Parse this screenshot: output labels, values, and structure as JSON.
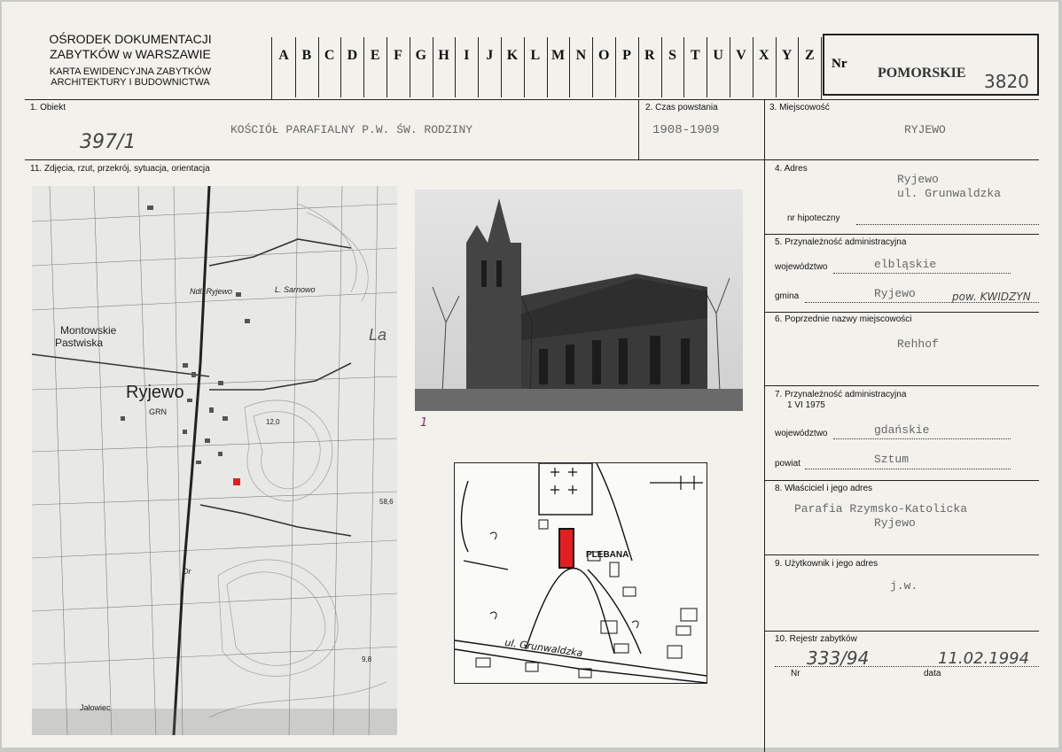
{
  "header": {
    "institution_line1": "OŚRODEK DOKUMENTACJI",
    "institution_line2": "ZABYTKÓW w WARSZAWIE",
    "card_line1": "KARTA EWIDENCYJNA ZABYTKÓW",
    "card_line2": "ARCHITEKTURY I BUDOWNICTWA",
    "alphabet": [
      "A",
      "B",
      "C",
      "D",
      "E",
      "F",
      "G",
      "H",
      "I",
      "J",
      "K",
      "L",
      "M",
      "N",
      "O",
      "P",
      "R",
      "S",
      "T",
      "U",
      "V",
      "X",
      "Y",
      "Z"
    ],
    "nr_label": "Nr",
    "region": "POMORSKIE",
    "region_number": "3820"
  },
  "fields": {
    "obiekt_label": "1. Obiekt",
    "obiekt_value": "KOŚCIÓŁ PARAFIALNY P.W. ŚW. RODZINY",
    "obiekt_handwritten": "397/1",
    "czas_label": "2. Czas powstania",
    "czas_value": "1908-1909",
    "miejscowosc_label": "3. Miejscowość",
    "miejscowosc_value": "RYJEWO",
    "zdjecia_label": "11. Zdjęcia, rzut, przekrój, sytuacja, orientacja",
    "adres_label": "4. Adres",
    "adres_line1": "Ryjewo",
    "adres_line2": "ul. Grunwaldzka",
    "hipoteczny_label": "nr hipoteczny",
    "przynaleznosc_label": "5. Przynależność administracyjna",
    "wojewodztwo_label": "województwo",
    "wojewodztwo_value": "elbląskie",
    "gmina_label": "gmina",
    "gmina_value": "Ryjewo",
    "gmina_handwritten": "pow. KWIDZYN",
    "poprzednie_label": "6. Poprzednie nazwy miejscowości",
    "poprzednie_value": "Rehhof",
    "przynaleznosc1975_label": "7. Przynależność administracyjna",
    "przynaleznosc1975_date": "1 VI 1975",
    "wojewodztwo1975_label": "województwo",
    "wojewodztwo1975_value": "gdańskie",
    "powiat_label": "powiat",
    "powiat_value": "Sztum",
    "wlasciciel_label": "8. Właściciel i jego adres",
    "wlasciciel_line1": "Parafia Rzymsko-Katolicka",
    "wlasciciel_line2": "Ryjewo",
    "uzytkownik_label": "9. Użytkownik i jego adres",
    "uzytkownik_value": "j.w.",
    "rejestr_label": "10. Rejestr zabytków",
    "rejestr_nr_label": "Nr",
    "rejestr_nr_value": "333/94",
    "rejestr_data_label": "data",
    "rejestr_data_value": "11.02.1994"
  },
  "map": {
    "labels": {
      "ryjewo": "Ryjewo",
      "grn": "GRN",
      "montowskie1": "Montowskie",
      "montowskie2": "Pastwiska",
      "ndl": "Ndl. Ryjewo",
      "sarnowo": "L. Sarnowo",
      "jalowiec": "Jałowiec",
      "elev1": "12,0",
      "elev2": "58,6",
      "elev3": "9,8",
      "la": "La",
      "dr": "Dr"
    }
  },
  "photo": {
    "number": "1"
  },
  "sketch": {
    "pleban": "PLEBANA",
    "street": "ul. Grunwaldzka"
  },
  "colors": {
    "paper": "#f2f1ec",
    "ink": "#222222",
    "red_mark": "#e02020"
  }
}
